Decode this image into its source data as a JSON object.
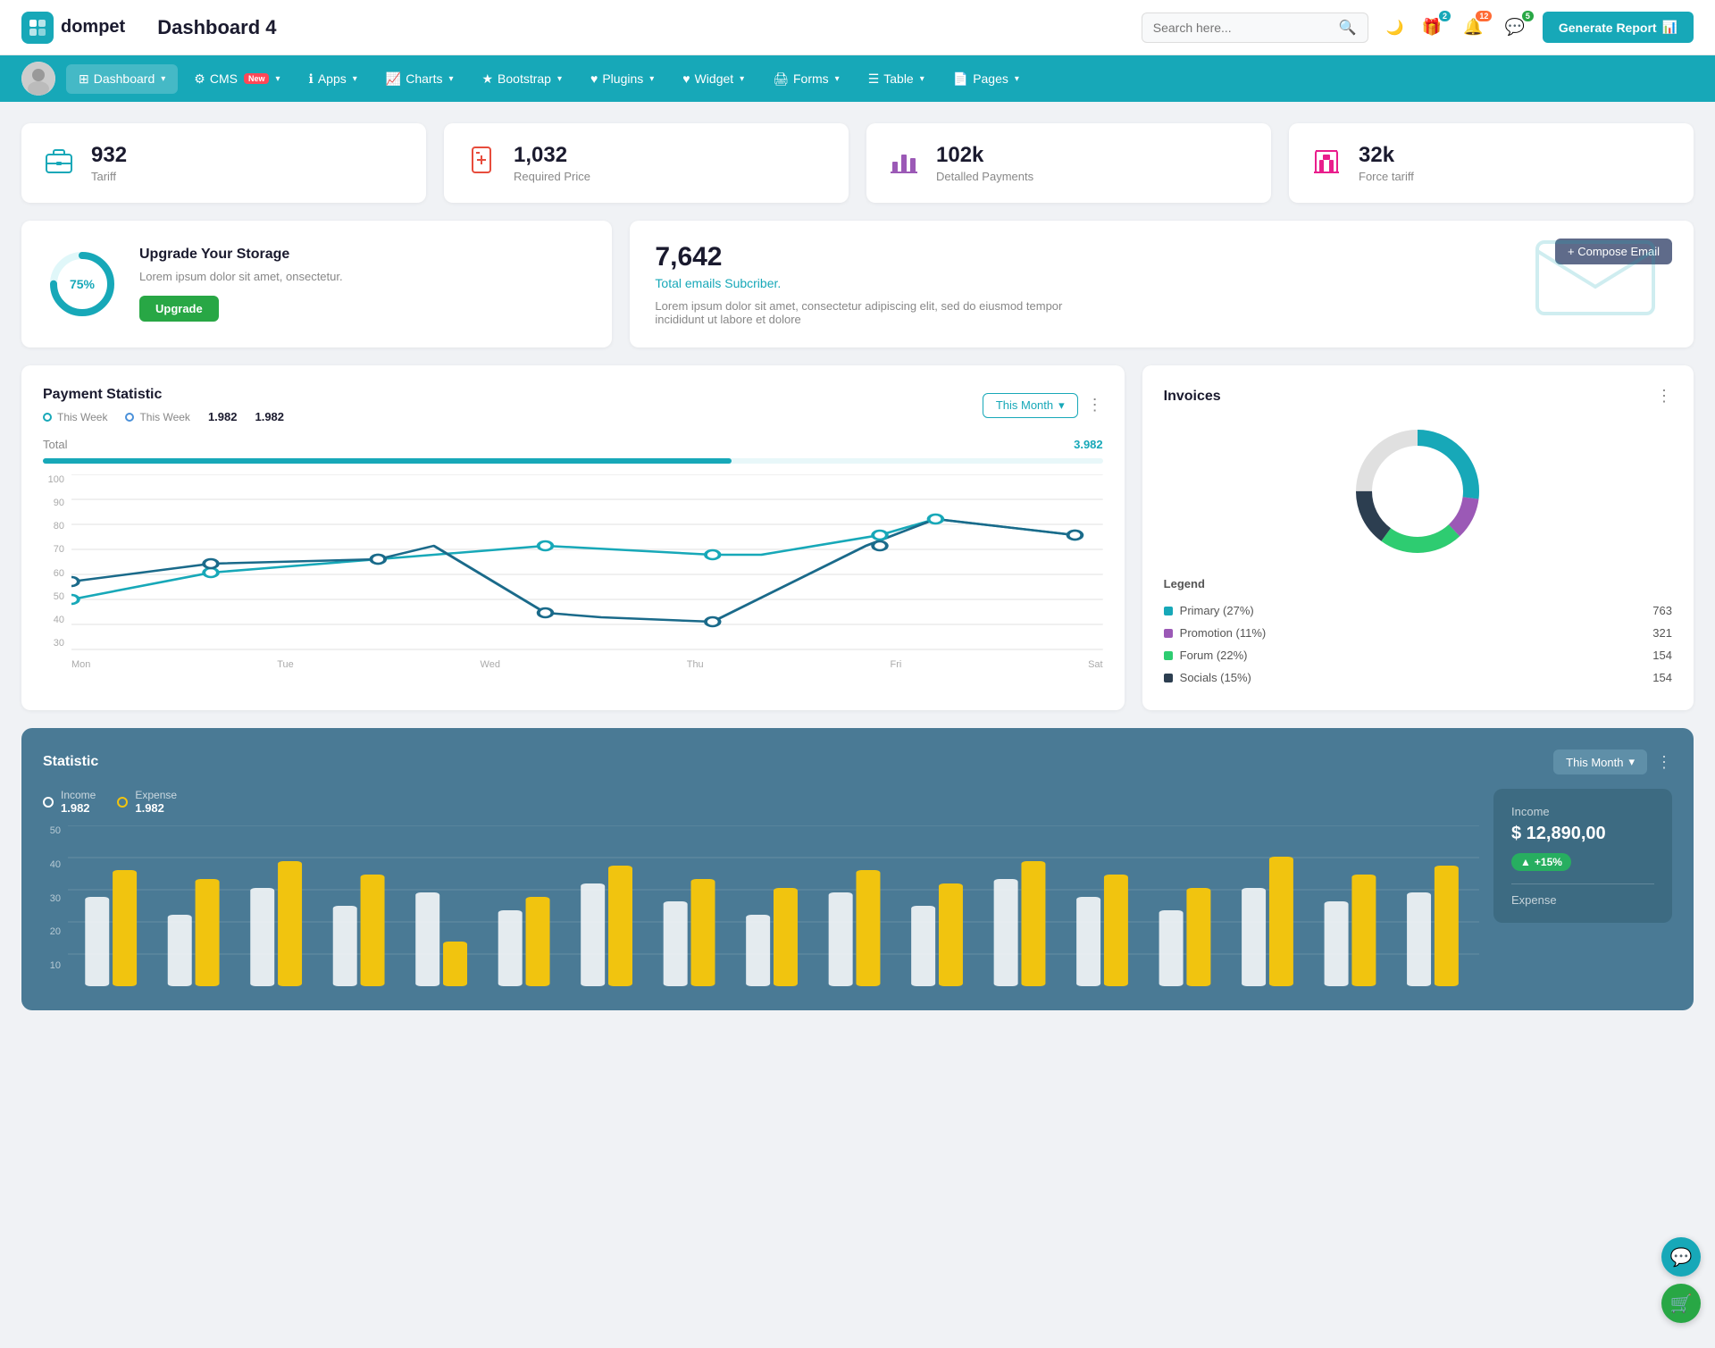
{
  "header": {
    "logo_text": "dompet",
    "title": "Dashboard 4",
    "search_placeholder": "Search here...",
    "generate_btn": "Generate Report",
    "badge_gift": "2",
    "badge_bell": "12",
    "badge_chat": "5"
  },
  "nav": {
    "items": [
      {
        "label": "Dashboard",
        "icon": "⊞",
        "active": true,
        "has_dropdown": true
      },
      {
        "label": "CMS",
        "icon": "⚙",
        "active": false,
        "has_dropdown": true,
        "badge_new": true
      },
      {
        "label": "Apps",
        "icon": "ℹ",
        "active": false,
        "has_dropdown": true
      },
      {
        "label": "Charts",
        "icon": "📈",
        "active": false,
        "has_dropdown": true
      },
      {
        "label": "Bootstrap",
        "icon": "★",
        "active": false,
        "has_dropdown": true
      },
      {
        "label": "Plugins",
        "icon": "♥",
        "active": false,
        "has_dropdown": true
      },
      {
        "label": "Widget",
        "icon": "♥",
        "active": false,
        "has_dropdown": true
      },
      {
        "label": "Forms",
        "icon": "🖨",
        "active": false,
        "has_dropdown": true
      },
      {
        "label": "Table",
        "icon": "☰",
        "active": false,
        "has_dropdown": true
      },
      {
        "label": "Pages",
        "icon": "📄",
        "active": false,
        "has_dropdown": true
      }
    ]
  },
  "stat_cards": [
    {
      "value": "932",
      "label": "Tariff",
      "icon": "briefcase",
      "color": "teal"
    },
    {
      "value": "1,032",
      "label": "Required Price",
      "icon": "file-medical",
      "color": "red"
    },
    {
      "value": "102k",
      "label": "Detalled Payments",
      "icon": "chart-bar",
      "color": "purple"
    },
    {
      "value": "32k",
      "label": "Force tariff",
      "icon": "building",
      "color": "pink"
    }
  ],
  "storage": {
    "percent": "75%",
    "percent_num": 75,
    "title": "Upgrade Your Storage",
    "description": "Lorem ipsum dolor sit amet, onsectetur.",
    "btn_label": "Upgrade"
  },
  "email": {
    "count": "7,642",
    "subtitle": "Total emails Subcriber.",
    "description": "Lorem ipsum dolor sit amet, consectetur adipiscing elit, sed do eiusmod tempor incididunt ut labore et dolore",
    "compose_btn": "+ Compose Email"
  },
  "payment_statistic": {
    "title": "Payment Statistic",
    "filter_label": "This Month",
    "legend1_label": "This Week",
    "legend1_value": "1.982",
    "legend2_label": "This Week",
    "legend2_value": "1.982",
    "total_label": "Total",
    "total_value": "3.982",
    "x_labels": [
      "Mon",
      "Tue",
      "Wed",
      "Thu",
      "Fri",
      "Sat"
    ],
    "y_labels": [
      "100",
      "90",
      "80",
      "70",
      "60",
      "50",
      "40",
      "30"
    ],
    "line1_points": "40,220 90,195 180,175 250,155 330,170 410,175 490,170 570,150 640,130 720,155",
    "line2_points": "40,200 90,180 180,160 250,145 330,165 410,170 490,165 570,140 640,120 720,145"
  },
  "invoices": {
    "title": "Invoices",
    "legend": [
      {
        "label": "Primary (27%)",
        "color": "#17a8b8",
        "value": "763"
      },
      {
        "label": "Promotion (11%)",
        "color": "#9b59b6",
        "value": "321"
      },
      {
        "label": "Forum (22%)",
        "color": "#2ecc71",
        "value": "154"
      },
      {
        "label": "Socials (15%)",
        "color": "#2c3e50",
        "value": "154"
      }
    ],
    "donut": {
      "segments": [
        {
          "label": "Primary",
          "percent": 27,
          "color": "#17a8b8"
        },
        {
          "label": "Promotion",
          "percent": 11,
          "color": "#9b59b6"
        },
        {
          "label": "Forum",
          "percent": 22,
          "color": "#2ecc71"
        },
        {
          "label": "Socials",
          "percent": 15,
          "color": "#2c3e50"
        }
      ]
    }
  },
  "statistic": {
    "title": "Statistic",
    "filter_label": "This Month",
    "income_label": "Income",
    "income_value": "1.982",
    "expense_label": "Expense",
    "expense_value": "1.982",
    "y_labels": [
      "50",
      "40",
      "30",
      "20",
      "10"
    ],
    "x_labels": [
      "",
      "",
      "",
      "",
      "",
      "",
      "",
      "",
      "",
      "",
      "",
      "",
      "",
      "",
      "",
      "",
      "",
      ""
    ],
    "income_panel": {
      "label": "Income",
      "value": "$ 12,890,00",
      "change": "+15%"
    },
    "expense_panel": {
      "label": "Expense"
    }
  }
}
